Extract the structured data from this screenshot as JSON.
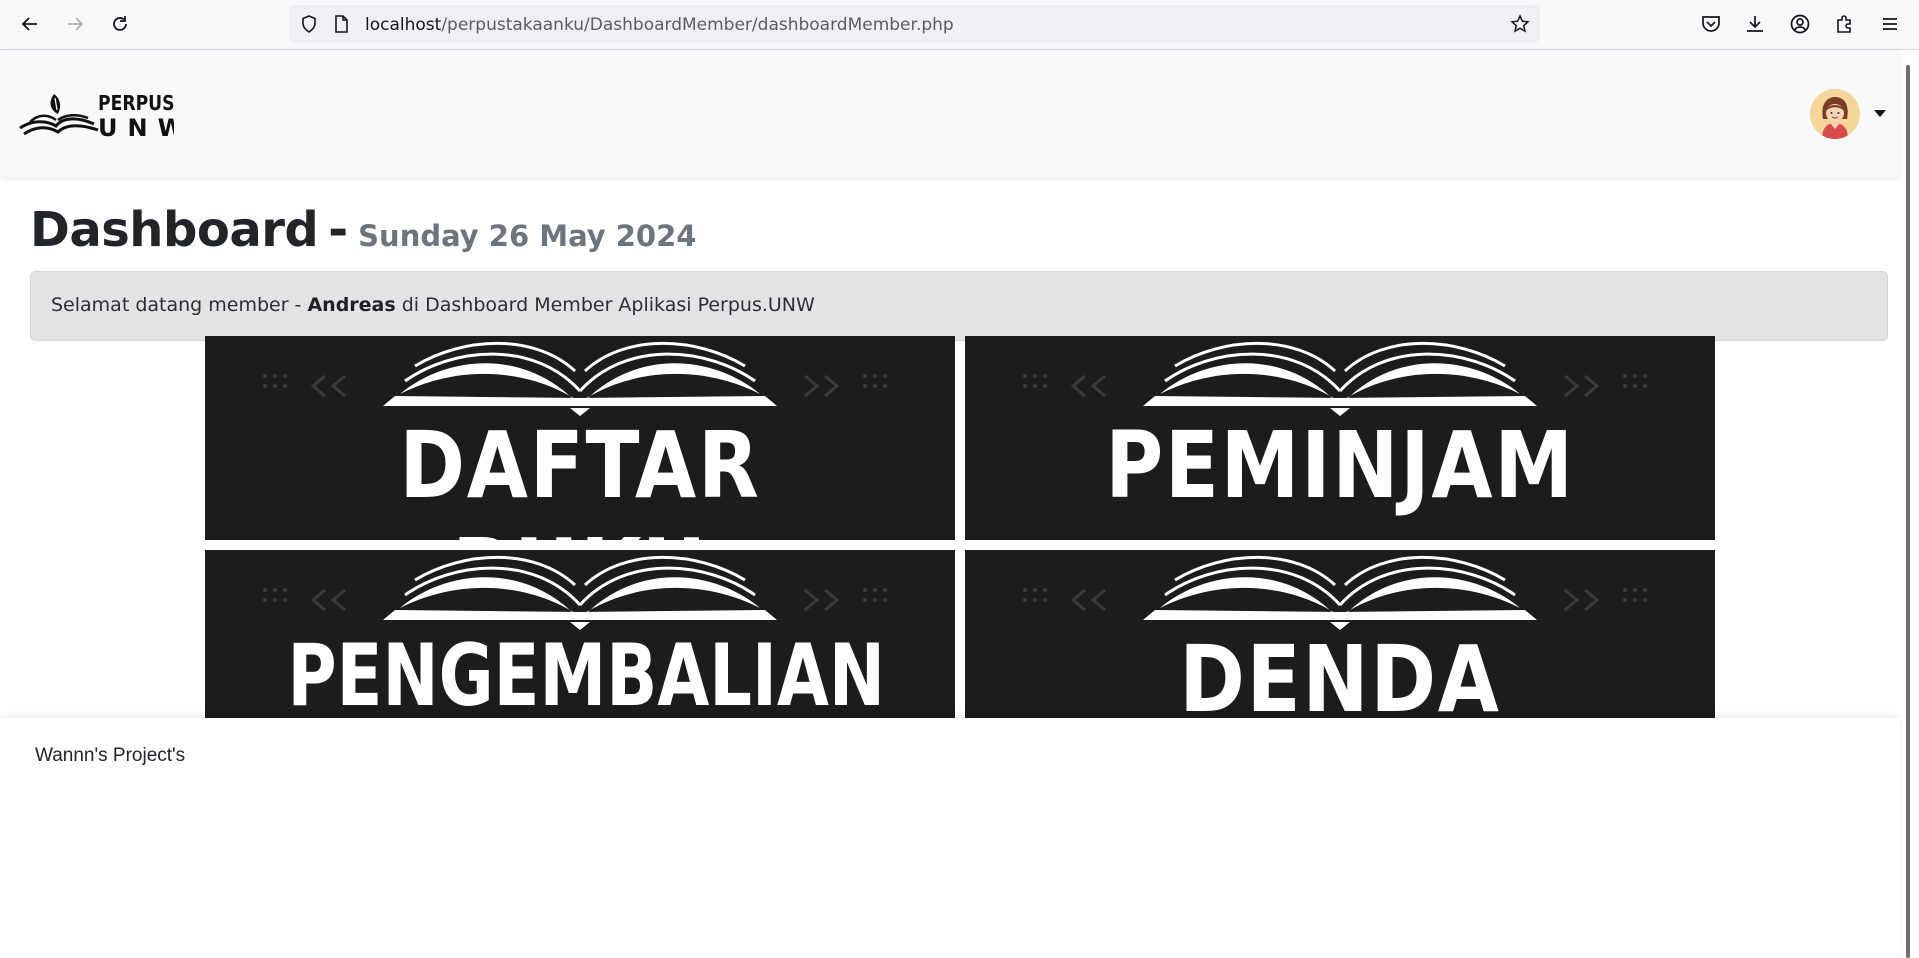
{
  "browser": {
    "url_host": "localhost",
    "url_path": "/perpustakaanku/DashboardMember/dashboardMember.php"
  },
  "navbar": {
    "brand_line1": "PERPUS",
    "brand_line2": "UNW",
    "avatar_icon": "user-avatar-icon"
  },
  "header": {
    "title": "Dashboard",
    "separator": "-",
    "date": "Sunday 26 May 2024"
  },
  "welcome": {
    "prefix": "Selamat datang member - ",
    "name": "Andreas",
    "suffix": " di Dashboard Member Aplikasi Perpus.UNW"
  },
  "tiles": [
    {
      "label": "DAFTAR BUKU"
    },
    {
      "label": "PEMINJAM"
    },
    {
      "label": "PENGEMBALIAN"
    },
    {
      "label": "DENDA"
    }
  ],
  "footer": {
    "text": "Wannn's Project's"
  },
  "colors": {
    "tile_bg": "#1c1c1c",
    "alert_bg": "#e2e3e5",
    "date_gray": "#6c757d"
  }
}
